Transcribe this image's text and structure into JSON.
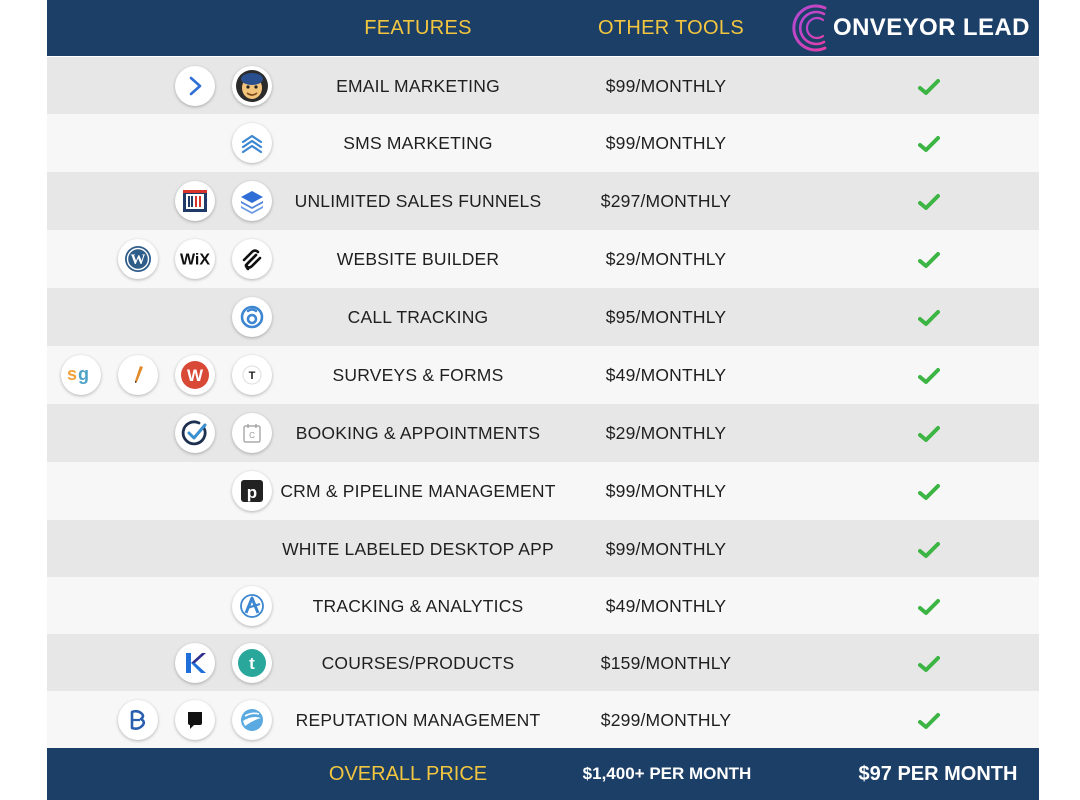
{
  "header": {
    "features_label": "FEATURES",
    "other_tools_label": "OTHER TOOLS",
    "brand_name": "ONVEYOR LEAD",
    "brand_logo_icon": "arc-logo-icon"
  },
  "colors": {
    "header_bg": "#1c3f67",
    "header_accent": "#f3c63f",
    "check_green": "#3db544"
  },
  "rows": [
    {
      "feature": "EMAIL MARKETING",
      "price": "$99/MONTHLY",
      "included": true,
      "tools": [
        "activecampaign-icon",
        "mailchimp-icon"
      ]
    },
    {
      "feature": "SMS MARKETING",
      "price": "$99/MONTHLY",
      "included": true,
      "tools": [
        "chevron-stack-icon"
      ]
    },
    {
      "feature": "UNLIMITED SALES FUNNELS",
      "price": "$297/MONTHLY",
      "included": true,
      "tools": [
        "clickfunnels-icon",
        "layers-icon"
      ]
    },
    {
      "feature": "WEBSITE BUILDER",
      "price": "$29/MONTHLY",
      "included": true,
      "tools": [
        "wordpress-icon",
        "wix-icon",
        "squarespace-icon"
      ]
    },
    {
      "feature": "CALL TRACKING",
      "price": "$95/MONTHLY",
      "included": true,
      "tools": [
        "calltracking-icon"
      ]
    },
    {
      "feature": "SURVEYS & FORMS",
      "price": "$49/MONTHLY",
      "included": true,
      "tools": [
        "surveygizmo-icon",
        "pen-icon",
        "wufoo-icon",
        "typeform-icon"
      ]
    },
    {
      "feature": "BOOKING & APPOINTMENTS",
      "price": "$29/MONTHLY",
      "included": true,
      "tools": [
        "check-circle-icon",
        "calendar-icon"
      ]
    },
    {
      "feature": "CRM & PIPELINE MANAGEMENT",
      "price": "$99/MONTHLY",
      "included": true,
      "tools": [
        "pipedrive-icon"
      ]
    },
    {
      "feature": "WHITE LABELED DESKTOP APP",
      "price": "$99/MONTHLY",
      "included": true,
      "tools": []
    },
    {
      "feature": "TRACKING & ANALYTICS",
      "price": "$49/MONTHLY",
      "included": true,
      "tools": [
        "analytics-a-icon"
      ]
    },
    {
      "feature": "COURSES/PRODUCTS",
      "price": "$159/MONTHLY",
      "included": true,
      "tools": [
        "kajabi-icon",
        "teachable-icon"
      ]
    },
    {
      "feature": "REPUTATION MANAGEMENT",
      "price": "$299/MONTHLY",
      "included": true,
      "tools": [
        "birdeye-icon",
        "podium-icon",
        "swirl-icon"
      ]
    }
  ],
  "footer": {
    "label": "OVERALL PRICE",
    "other_total": "$1,400+ PER MONTH",
    "our_total": "$97 PER MONTH"
  }
}
